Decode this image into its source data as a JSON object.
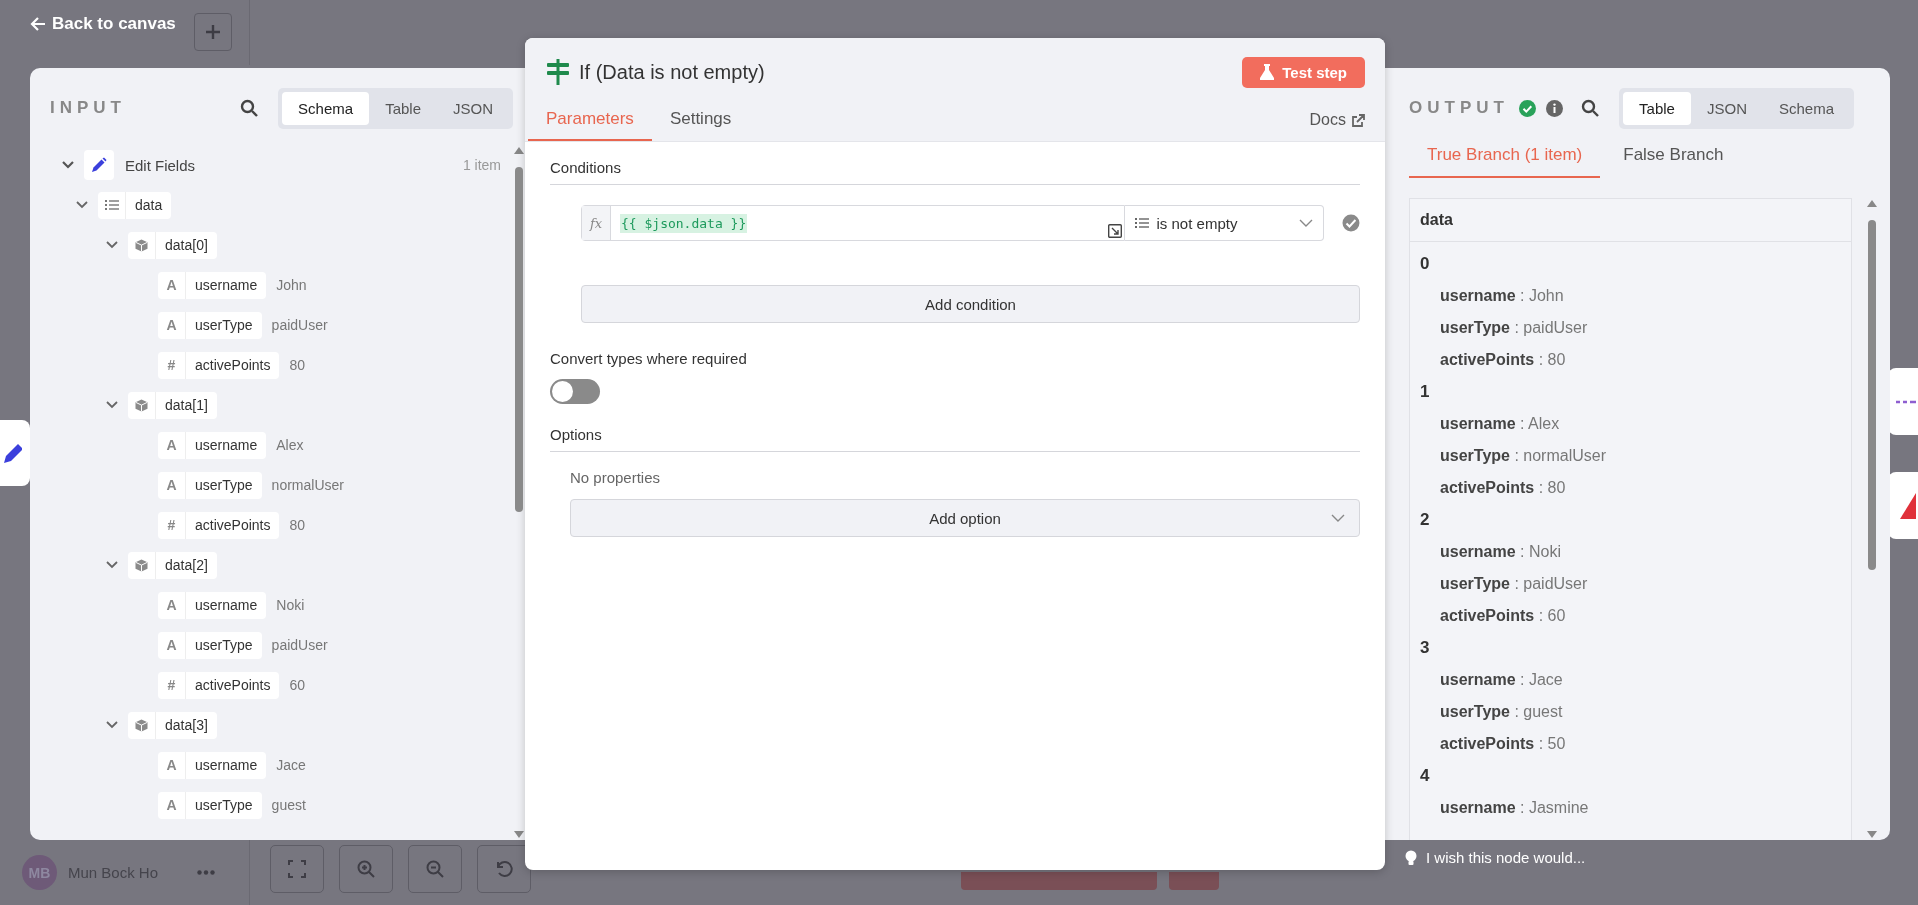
{
  "header": {
    "back_link": "Back to canvas"
  },
  "user": {
    "initials": "MB",
    "name": "Mun Bock Ho"
  },
  "input": {
    "title": "INPUT",
    "tabs": [
      {
        "label": "Schema",
        "selected": true
      },
      {
        "label": "Table",
        "selected": false
      },
      {
        "label": "JSON",
        "selected": false
      }
    ],
    "node": {
      "name": "Edit Fields",
      "count": "1 item",
      "expanded": true
    },
    "tree": [
      {
        "kind": "array",
        "name": "data",
        "expanded": true,
        "children": [
          {
            "kind": "object",
            "name": "data[0]",
            "expanded": true,
            "children": [
              {
                "kind": "field",
                "type_icon": "A",
                "name": "username",
                "value": "John"
              },
              {
                "kind": "field",
                "type_icon": "A",
                "name": "userType",
                "value": "paidUser"
              },
              {
                "kind": "field",
                "type_icon": "#",
                "name": "activePoints",
                "value": "80"
              }
            ]
          },
          {
            "kind": "object",
            "name": "data[1]",
            "expanded": true,
            "children": [
              {
                "kind": "field",
                "type_icon": "A",
                "name": "username",
                "value": "Alex"
              },
              {
                "kind": "field",
                "type_icon": "A",
                "name": "userType",
                "value": "normalUser"
              },
              {
                "kind": "field",
                "type_icon": "#",
                "name": "activePoints",
                "value": "80"
              }
            ]
          },
          {
            "kind": "object",
            "name": "data[2]",
            "expanded": true,
            "children": [
              {
                "kind": "field",
                "type_icon": "A",
                "name": "username",
                "value": "Noki"
              },
              {
                "kind": "field",
                "type_icon": "A",
                "name": "userType",
                "value": "paidUser"
              },
              {
                "kind": "field",
                "type_icon": "#",
                "name": "activePoints",
                "value": "60"
              }
            ]
          },
          {
            "kind": "object",
            "name": "data[3]",
            "expanded": true,
            "children": [
              {
                "kind": "field",
                "type_icon": "A",
                "name": "username",
                "value": "Jace"
              },
              {
                "kind": "field",
                "type_icon": "A",
                "name": "userType",
                "value": "guest"
              }
            ]
          }
        ]
      }
    ]
  },
  "node": {
    "title": "If (Data is not empty)",
    "test_button": "Test step",
    "tabs": [
      {
        "label": "Parameters",
        "selected": true
      },
      {
        "label": "Settings",
        "selected": false
      }
    ],
    "docs": "Docs",
    "conditions_label": "Conditions",
    "condition": {
      "mode_icon": "fx",
      "expression": "{{ $json.data }}",
      "operator": "is not empty",
      "valid": true
    },
    "add_condition": "Add condition",
    "convert_label": "Convert types where required",
    "convert": {
      "on": false
    },
    "options_label": "Options",
    "no_properties": "No properties",
    "add_option": "Add option"
  },
  "output": {
    "title": "OUTPUT",
    "success": true,
    "tabs": [
      {
        "label": "Table",
        "selected": true
      },
      {
        "label": "JSON",
        "selected": false
      },
      {
        "label": "Schema",
        "selected": false
      }
    ],
    "branches": [
      {
        "label": "True Branch (1 item)",
        "selected": true
      },
      {
        "label": "False Branch",
        "selected": false
      }
    ],
    "column": "data",
    "items": [
      {
        "index": "0",
        "fields": [
          "**username** : John",
          "**userType** : paidUser",
          "**activePoints** : 80"
        ]
      },
      {
        "index": "1",
        "fields": [
          "**username** : Alex",
          "**userType** : normalUser",
          "**activePoints** : 80"
        ]
      },
      {
        "index": "2",
        "fields": [
          "**username** : Noki",
          "**userType** : paidUser",
          "**activePoints** : 60"
        ]
      },
      {
        "index": "3",
        "fields": [
          "**username** : Jace",
          "**userType** : guest",
          "**activePoints** : 50"
        ]
      },
      {
        "index": "4",
        "fields": [
          "**username** : Jasmine"
        ]
      }
    ]
  },
  "feedback": "I wish this node would..."
}
